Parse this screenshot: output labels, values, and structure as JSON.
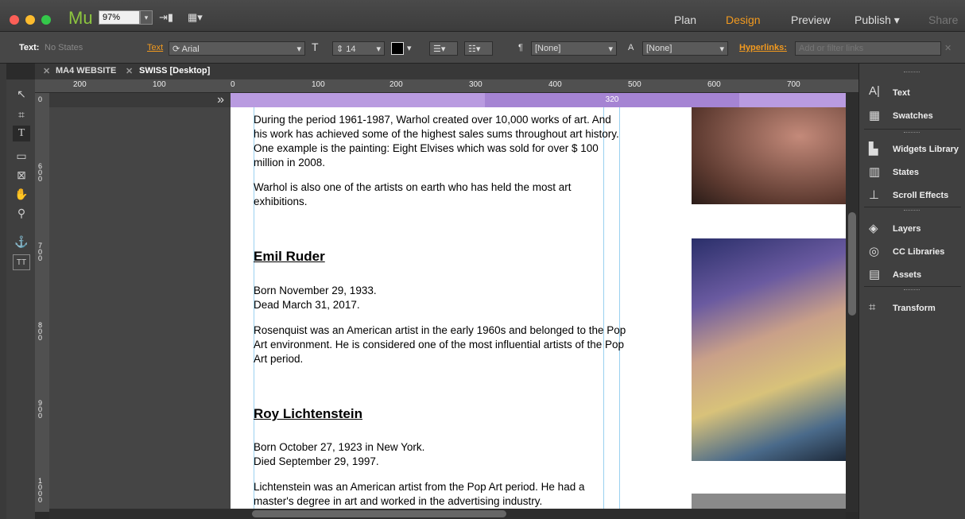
{
  "app": {
    "name": "Mu",
    "zoom": "97%"
  },
  "nav": {
    "plan": "Plan",
    "design": "Design",
    "preview": "Preview",
    "publish": "Publish ▾",
    "share": "Share",
    "accent_color": "#f29a1f"
  },
  "toolbar": {
    "text_states_label": "Text:",
    "text_states_value": "No States",
    "text_label": "Text",
    "font": "Arial",
    "size": "14",
    "none1": "[None]",
    "none2": "[None]",
    "hyperlinks_label": "Hyperlinks:",
    "hyperlinks_placeholder": "Add or filter links"
  },
  "tabs": [
    {
      "label": "MA4 WEBSITE"
    },
    {
      "label": "SWISS [Desktop]"
    }
  ],
  "ruler": {
    "h": [
      "200",
      "100",
      "0",
      "100",
      "200",
      "300",
      "400",
      "500",
      "600",
      "700"
    ],
    "v": [
      "0",
      "600",
      "700",
      "800",
      "900",
      "1000"
    ]
  },
  "breakpoint": {
    "value": "320",
    "expand": "»"
  },
  "content": {
    "p1": "During the period 1961-1987, Warhol created over 10,000 works of art. And his work has achieved some of the highest sales sums throughout art history. One example is the painting: Eight Elvises which was sold for over $ 100 million in 2008.",
    "p2": "Warhol is also one of the artists on earth who has held the most art exhibitions.",
    "h1": "Emil Ruder",
    "b1a": "Born November 29, 1933.",
    "b1b": "Dead March 31, 2017.",
    "p3": "Rosenquist was an American artist in the early 1960s and belonged to the Pop Art environment. He is considered one of the most influential artists of the Pop Art period.",
    "h2": "Roy Lichtenstein",
    "b2a": "Born October 27, 1923 in New York.",
    "b2b": "Died September 29, 1997.",
    "p4": "Lichtenstein was an American artist from the Pop Art period. He had a master's degree in art and worked in the advertising industry."
  },
  "panel": {
    "text": "Text",
    "swatches": "Swatches",
    "widgets": "Widgets Library",
    "states": "States",
    "scroll": "Scroll Effects",
    "layers": "Layers",
    "cc": "CC Libraries",
    "assets": "Assets",
    "transform": "Transform"
  }
}
